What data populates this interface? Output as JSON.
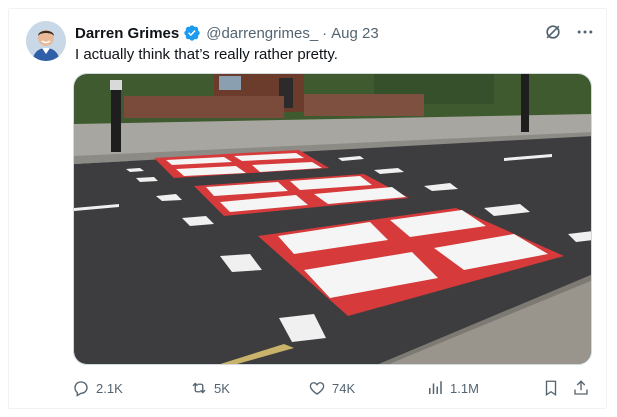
{
  "author": {
    "display_name": "Darren Grimes",
    "handle": "@darrengrimes_",
    "separator": "·",
    "date": "Aug 23",
    "verified_icon": "verified-badge-icon"
  },
  "tweet": {
    "text": "I actually think that’s really rather pretty."
  },
  "media": {
    "icon": "photo"
  },
  "top_icons": [
    "grok-icon",
    "more-icon"
  ],
  "actions": {
    "replies": "2.1K",
    "reposts": "5K",
    "likes": "74K",
    "views": "1.1M"
  },
  "colors": {
    "verified": "#1d9bf0",
    "text_secondary": "#536471",
    "text_primary": "#0f1419",
    "road": "#3c3c3c",
    "st_george_red": "#d63a3a",
    "marking_white": "#f5f5f5"
  }
}
